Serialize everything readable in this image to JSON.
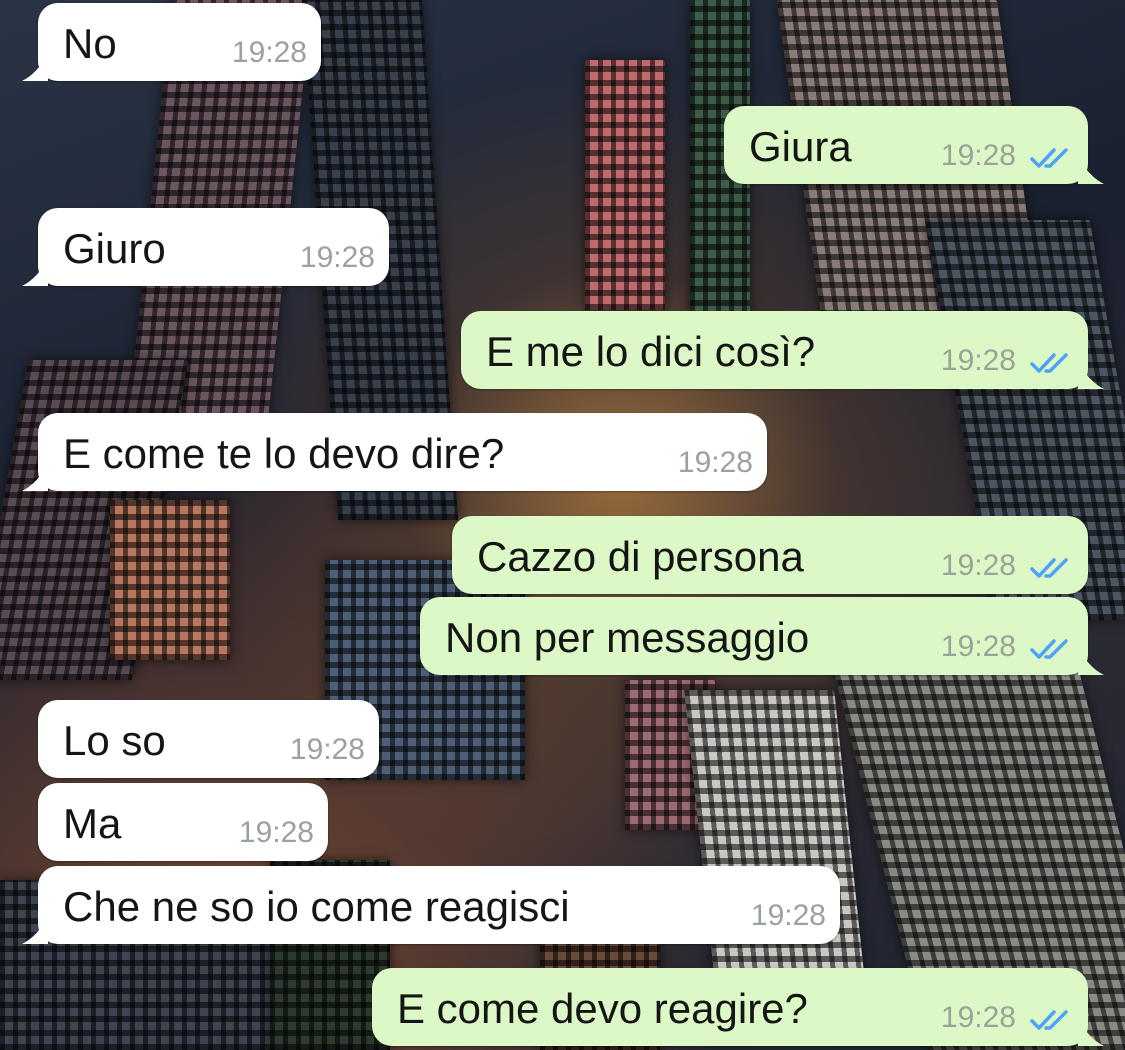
{
  "messages": [
    {
      "direction": "in",
      "text": "No",
      "time": "19:28"
    },
    {
      "direction": "out",
      "text": "Giura",
      "time": "19:28",
      "status": "read"
    },
    {
      "direction": "in",
      "text": "Giuro",
      "time": "19:28"
    },
    {
      "direction": "out",
      "text": "E me lo dici così?",
      "time": "19:28",
      "status": "read"
    },
    {
      "direction": "in",
      "text": "E come te lo devo dire?",
      "time": "19:28"
    },
    {
      "direction": "out",
      "text": "Cazzo di persona",
      "time": "19:28",
      "status": "read"
    },
    {
      "direction": "out",
      "text": "Non per messaggio",
      "time": "19:28",
      "status": "read"
    },
    {
      "direction": "in",
      "text": "Lo so",
      "time": "19:28"
    },
    {
      "direction": "in",
      "text": "Ma",
      "time": "19:28"
    },
    {
      "direction": "in",
      "text": "Che ne so io come reagisci",
      "time": "19:28"
    },
    {
      "direction": "out",
      "text": "E come devo reagire?",
      "time": "19:28",
      "status": "read"
    }
  ],
  "colors": {
    "incoming_bubble": "#ffffff",
    "outgoing_bubble": "#dcf8c6",
    "read_ticks": "#4fa3f7",
    "timestamp": "#9aa39a"
  },
  "background": "night city skyline seen from above"
}
